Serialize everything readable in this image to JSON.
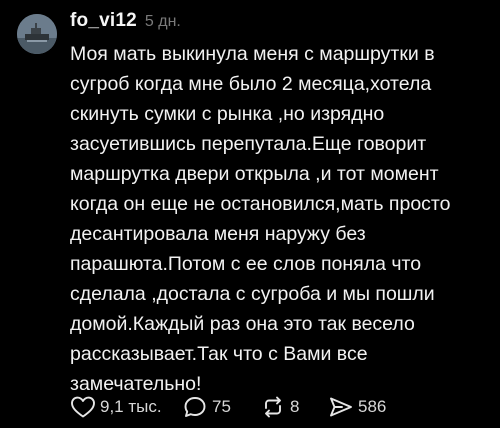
{
  "post": {
    "username": "fo_vi12",
    "time": "5 дн.",
    "text_lines": [
      "Моя мать выкинула меня с маршрутки в",
      "сугроб когда мне было 2 месяца,хотела",
      "скинуть сумки с рынка ,но изрядно",
      "засуетившись перепутала.Еще говорит",
      "маршрутка двери открыла ,и тот момент",
      "когда он еще не остановился,мать просто",
      "десантировала меня наружу без",
      "парашюта.Потом с ее слов поняла что",
      "сделала ,достала с сугроба и мы пошли",
      "домой.Каждый раз она это так весело",
      "рассказывает.Так что с Вами все",
      "замечательно!"
    ],
    "stats": {
      "likes": "9,1 тыс.",
      "replies": "75",
      "reposts": "8",
      "shares": "586"
    }
  },
  "icons": {
    "like": "heart-icon",
    "reply": "comment-bubble-icon",
    "repost": "repost-arrows-icon",
    "share": "send-icon"
  },
  "colors": {
    "background": "#000000",
    "text": "#f2f2f2",
    "muted": "#7a7a7a"
  }
}
